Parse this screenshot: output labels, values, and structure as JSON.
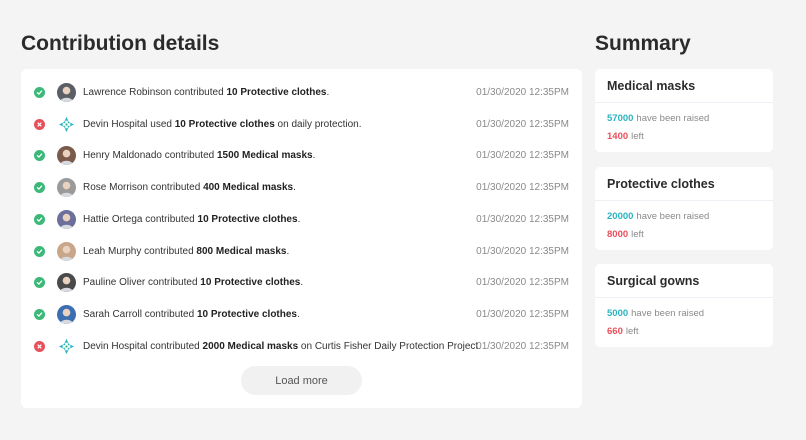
{
  "contributions": {
    "title": "Contribution details",
    "rows": [
      {
        "status": "success",
        "avatar": "person-avatar",
        "prefix": "Lawrence Robinson contributed ",
        "item": "10 Protective clothes",
        "suffix": ".",
        "time": "01/30/2020 12:35PM"
      },
      {
        "status": "error",
        "avatar": "hospital-logo",
        "prefix": "Devin Hospital used ",
        "item": "10 Protective clothes",
        "suffix": " on daily protection.",
        "time": "01/30/2020 12:35PM"
      },
      {
        "status": "success",
        "avatar": "person-avatar",
        "prefix": "Henry Maldonado contributed ",
        "item": "1500 Medical masks",
        "suffix": ".",
        "time": "01/30/2020 12:35PM"
      },
      {
        "status": "success",
        "avatar": "person-avatar",
        "prefix": "Rose Morrison contributed ",
        "item": "400 Medical masks",
        "suffix": ".",
        "time": "01/30/2020 12:35PM"
      },
      {
        "status": "success",
        "avatar": "person-avatar",
        "prefix": "Hattie Ortega contributed ",
        "item": "10 Protective clothes",
        "suffix": ".",
        "time": "01/30/2020 12:35PM"
      },
      {
        "status": "success",
        "avatar": "person-avatar",
        "prefix": "Leah Murphy contributed ",
        "item": "800 Medical masks",
        "suffix": ".",
        "time": "01/30/2020 12:35PM"
      },
      {
        "status": "success",
        "avatar": "person-avatar",
        "prefix": "Pauline Oliver contributed ",
        "item": "10 Protective clothes",
        "suffix": ".",
        "time": "01/30/2020 12:35PM"
      },
      {
        "status": "success",
        "avatar": "person-avatar",
        "prefix": "Sarah Carroll contributed ",
        "item": "10 Protective clothes",
        "suffix": ".",
        "time": "01/30/2020 12:35PM"
      },
      {
        "status": "error",
        "avatar": "hospital-logo",
        "prefix": "Devin Hospital contributed ",
        "item": "2000 Medical masks",
        "suffix": " on Curtis Fisher Daily Protection Project.",
        "time": "01/30/2020 12:35PM"
      }
    ],
    "load_more_label": "Load more"
  },
  "summary": {
    "title": "Summary",
    "cards": [
      {
        "name": "Medical masks",
        "raised": "57000",
        "raised_label": "have been raised",
        "left": "1400",
        "left_label": "left"
      },
      {
        "name": "Protective clothes",
        "raised": "20000",
        "raised_label": "have been raised",
        "left": "8000",
        "left_label": "left"
      },
      {
        "name": "Surgical gowns",
        "raised": "5000",
        "raised_label": "have been raised",
        "left": "660",
        "left_label": "left"
      }
    ]
  },
  "colors": {
    "success": "#3cb878",
    "error": "#e8505b",
    "raised": "#2ab3c0",
    "left": "#e8505b",
    "page_background": "#f4f4f4"
  }
}
